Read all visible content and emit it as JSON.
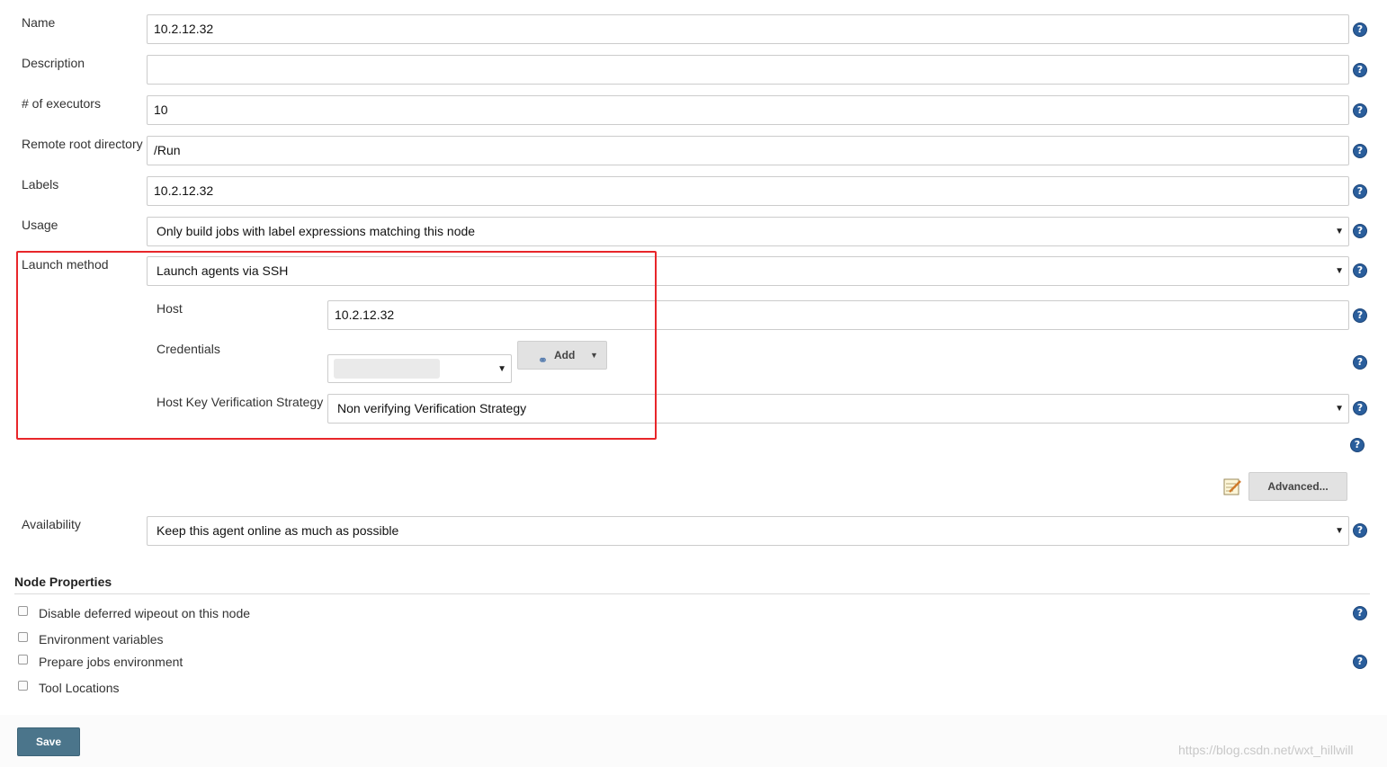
{
  "form": {
    "name": {
      "label": "Name",
      "value": "10.2.12.32"
    },
    "description": {
      "label": "Description",
      "value": ""
    },
    "executors": {
      "label": "# of executors",
      "value": "10"
    },
    "remote_root": {
      "label": "Remote root directory",
      "value": "/Run"
    },
    "labels": {
      "label": "Labels",
      "value": "10.2.12.32"
    },
    "usage": {
      "label": "Usage",
      "value": "Only build jobs with label expressions matching this node"
    },
    "launch_method": {
      "label": "Launch method",
      "value": "Launch agents via SSH"
    },
    "ssh": {
      "host": {
        "label": "Host",
        "value": "10.2.12.32"
      },
      "credentials": {
        "label": "Credentials",
        "value": "",
        "add_label": "Add"
      },
      "host_key": {
        "label": "Host Key Verification Strategy",
        "value": "Non verifying Verification Strategy"
      }
    },
    "advanced_label": "Advanced...",
    "availability": {
      "label": "Availability",
      "value": "Keep this agent online as much as possible"
    }
  },
  "node_properties": {
    "title": "Node Properties",
    "items": [
      {
        "label": "Disable deferred wipeout on this node",
        "checked": false
      },
      {
        "label": "Environment variables",
        "checked": false
      },
      {
        "label": "Prepare jobs environment",
        "checked": false
      },
      {
        "label": "Tool Locations",
        "checked": false
      }
    ]
  },
  "save_label": "Save",
  "help_symbol": "?",
  "dropdown_symbol": "▼",
  "watermark": "https://blog.csdn.net/wxt_hillwill",
  "colors": {
    "highlight_border": "#e8262a",
    "save_button": "#4b758b",
    "help_icon": "#2a5e9c"
  }
}
